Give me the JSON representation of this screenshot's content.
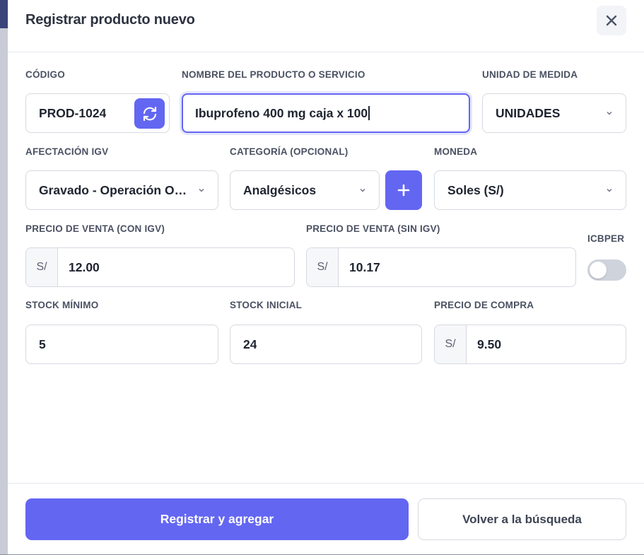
{
  "modal": {
    "title": "Registrar producto nuevo"
  },
  "fields": {
    "codigo": {
      "label": "CÓDIGO",
      "value": "PROD-1024"
    },
    "nombre": {
      "label": "NOMBRE DEL PRODUCTO O SERVICIO",
      "value": "Ibuprofeno 400 mg caja x 100"
    },
    "unidad": {
      "label": "UNIDAD DE MEDIDA",
      "value": "UNIDADES"
    },
    "afectacion": {
      "label": "AFECTACIÓN IGV",
      "value": "Gravado - Operación One..."
    },
    "categoria": {
      "label": "CATEGORÍA (OPCIONAL)",
      "value": "Analgésicos"
    },
    "moneda": {
      "label": "MONEDA",
      "value": "Soles (S/)"
    },
    "precio_con_igv": {
      "label": "PRECIO DE VENTA (CON IGV)",
      "prefix": "S/",
      "value": "12.00"
    },
    "precio_sin_igv": {
      "label": "PRECIO DE VENTA (SIN IGV)",
      "prefix": "S/",
      "value": "10.17"
    },
    "icbper": {
      "label": "ICBPER",
      "enabled": false
    },
    "stock_minimo": {
      "label": "STOCK MÍNIMO",
      "value": "5"
    },
    "stock_inicial": {
      "label": "STOCK INICIAL",
      "value": "24"
    },
    "precio_compra": {
      "label": "PRECIO DE COMPRA",
      "prefix": "S/",
      "value": "9.50"
    }
  },
  "buttons": {
    "primary": "Registrar y agregar",
    "secondary": "Volver a la búsqueda"
  },
  "icons": {
    "close": "close-icon",
    "refresh": "refresh-icon",
    "add": "plus-icon",
    "dropdown": "chevron-down-icon"
  },
  "colors": {
    "accent": "#6366f1",
    "text": "#1f2430",
    "label": "#4a5162",
    "border": "#d6d9e0"
  }
}
